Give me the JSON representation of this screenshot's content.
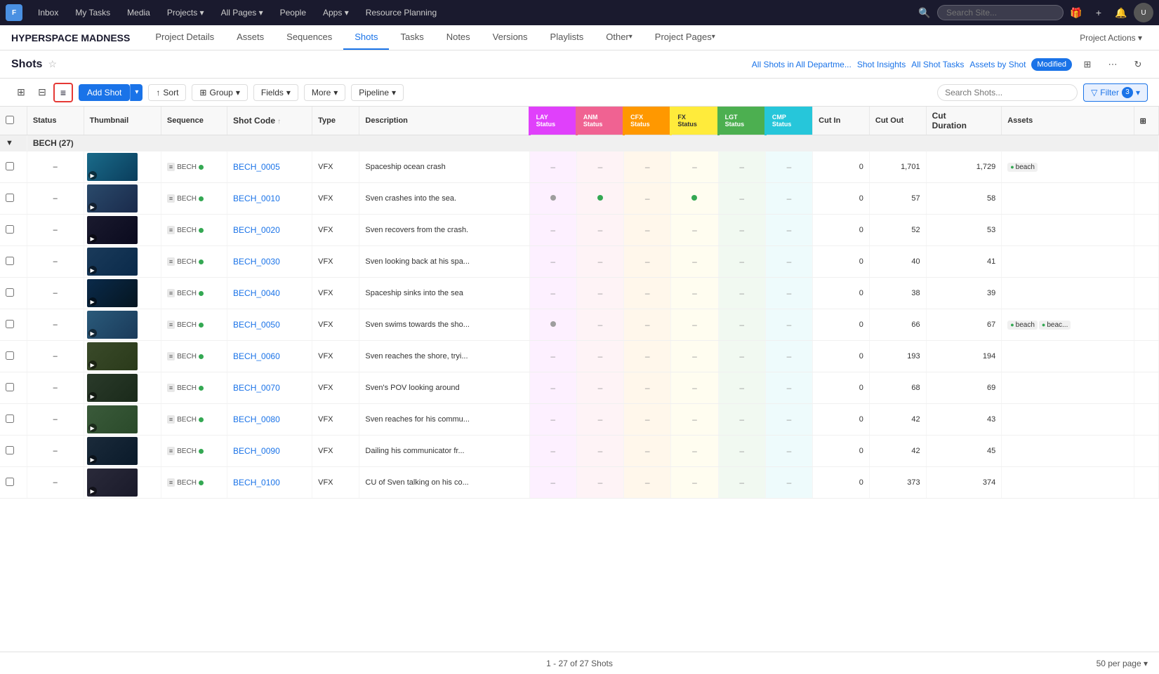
{
  "app": {
    "logo_text": "F",
    "nav_items": [
      "Inbox",
      "My Tasks",
      "Media",
      "Projects",
      "All Pages",
      "People",
      "Apps",
      "Resource Planning"
    ],
    "nav_with_arrow": [
      3,
      4,
      6
    ],
    "search_placeholder": "Search Site...",
    "project_name": "HYPERSPACE MADNESS",
    "project_actions_label": "Project Actions ▾"
  },
  "project_tabs": [
    {
      "label": "Project Details",
      "active": false
    },
    {
      "label": "Assets",
      "active": false
    },
    {
      "label": "Sequences",
      "active": false
    },
    {
      "label": "Shots",
      "active": true
    },
    {
      "label": "Tasks",
      "active": false
    },
    {
      "label": "Notes",
      "active": false
    },
    {
      "label": "Versions",
      "active": false
    },
    {
      "label": "Playlists",
      "active": false
    },
    {
      "label": "Other",
      "active": false,
      "arrow": true
    },
    {
      "label": "Project Pages",
      "active": false,
      "arrow": true
    }
  ],
  "page_title": "Shots",
  "page_header_links": [
    {
      "label": "All Shots in All Departme..."
    },
    {
      "label": "Shot Insights"
    },
    {
      "label": "All Shot Tasks"
    },
    {
      "label": "Assets by Shot"
    }
  ],
  "modified_badge": "Modified",
  "toolbar": {
    "add_shot_label": "Add Shot",
    "sort_label": "Sort",
    "group_label": "Group",
    "fields_label": "Fields",
    "more_label": "More",
    "pipeline_label": "Pipeline",
    "search_placeholder": "Search Shots...",
    "filter_label": "Filter",
    "filter_count": "3"
  },
  "columns": [
    {
      "label": "Status",
      "key": "status"
    },
    {
      "label": "Thumbnail",
      "key": "thumbnail"
    },
    {
      "label": "Sequence",
      "key": "sequence"
    },
    {
      "label": "Shot Code",
      "key": "shot_code",
      "sort": true
    },
    {
      "label": "Type",
      "key": "type"
    },
    {
      "label": "Description",
      "key": "description"
    },
    {
      "label": "LAY Status",
      "key": "lay_status",
      "pipeline": true,
      "color": "lay"
    },
    {
      "label": "ANM Status",
      "key": "anm_status",
      "pipeline": true,
      "color": "anm"
    },
    {
      "label": "CFX Status",
      "key": "cfx_status",
      "pipeline": true,
      "color": "cfx"
    },
    {
      "label": "FX Status",
      "key": "fx_status",
      "pipeline": true,
      "color": "fx"
    },
    {
      "label": "LGT Status",
      "key": "lgt_status",
      "pipeline": true,
      "color": "lgt"
    },
    {
      "label": "CMP Status",
      "key": "cmp_status",
      "pipeline": true,
      "color": "cmp"
    },
    {
      "label": "Cut In",
      "key": "cut_in"
    },
    {
      "label": "Cut Out",
      "key": "cut_out"
    },
    {
      "label": "Cut Duration",
      "key": "cut_duration"
    },
    {
      "label": "Assets",
      "key": "assets"
    }
  ],
  "group": {
    "name": "BECH",
    "count": 27
  },
  "shots": [
    {
      "id": "1",
      "status": "-",
      "thumb_class": "thumb-beach",
      "sequence": "BECH",
      "seq_dot": "green",
      "shot_code": "BECH_0005",
      "type": "VFX",
      "description": "Spaceship ocean crash",
      "lay": "",
      "anm": "",
      "cfx": "",
      "fx": "",
      "lgt": "",
      "cmp": "",
      "cut_in": "0",
      "cut_out": "1,701",
      "cut_duration": "1,729",
      "assets": "beach"
    },
    {
      "id": "2",
      "status": "-",
      "thumb_class": "thumb-crash",
      "sequence": "BECH",
      "seq_dot": "green",
      "shot_code": "BECH_0010",
      "type": "VFX",
      "description": "Sven crashes into the sea.",
      "lay": "gray",
      "anm": "green",
      "cfx": "",
      "fx": "green",
      "lgt": "",
      "cmp": "",
      "cut_in": "0",
      "cut_out": "57",
      "cut_duration": "58",
      "assets": ""
    },
    {
      "id": "3",
      "status": "-",
      "thumb_class": "thumb-recover",
      "sequence": "BECH",
      "seq_dot": "green",
      "shot_code": "BECH_0020",
      "type": "VFX",
      "description": "Sven recovers from the crash.",
      "lay": "",
      "anm": "",
      "cfx": "",
      "fx": "",
      "lgt": "",
      "cmp": "",
      "cut_in": "0",
      "cut_out": "52",
      "cut_duration": "53",
      "assets": ""
    },
    {
      "id": "4",
      "status": "-",
      "thumb_class": "thumb-look",
      "sequence": "BECH",
      "seq_dot": "green",
      "shot_code": "BECH_0030",
      "type": "VFX",
      "description": "Sven looking back at his spa...",
      "lay": "",
      "anm": "",
      "cfx": "",
      "fx": "",
      "lgt": "",
      "cmp": "",
      "cut_in": "0",
      "cut_out": "40",
      "cut_duration": "41",
      "assets": ""
    },
    {
      "id": "5",
      "status": "-",
      "thumb_class": "thumb-sink",
      "sequence": "BECH",
      "seq_dot": "green",
      "shot_code": "BECH_0040",
      "type": "VFX",
      "description": "Spaceship sinks into the sea",
      "lay": "",
      "anm": "",
      "cfx": "",
      "fx": "",
      "lgt": "",
      "cmp": "",
      "cut_in": "0",
      "cut_out": "38",
      "cut_duration": "39",
      "assets": ""
    },
    {
      "id": "6",
      "status": "-",
      "thumb_class": "thumb-swim",
      "sequence": "BECH",
      "seq_dot": "green",
      "shot_code": "BECH_0050",
      "type": "VFX",
      "description": "Sven swims towards the sho...",
      "lay": "gray",
      "anm": "",
      "cfx": "",
      "fx": "",
      "lgt": "",
      "cmp": "",
      "cut_in": "0",
      "cut_out": "66",
      "cut_duration": "67",
      "assets": "beach, beac..."
    },
    {
      "id": "7",
      "status": "-",
      "thumb_class": "thumb-shore",
      "sequence": "BECH",
      "seq_dot": "green",
      "shot_code": "BECH_0060",
      "type": "VFX",
      "description": "Sven reaches the shore, tryi...",
      "lay": "",
      "anm": "",
      "cfx": "",
      "fx": "",
      "lgt": "",
      "cmp": "",
      "cut_in": "0",
      "cut_out": "193",
      "cut_duration": "194",
      "assets": ""
    },
    {
      "id": "8",
      "status": "-",
      "thumb_class": "thumb-pov",
      "sequence": "BECH",
      "seq_dot": "green",
      "shot_code": "BECH_0070",
      "type": "VFX",
      "description": "Sven's POV looking around",
      "lay": "",
      "anm": "",
      "cfx": "",
      "fx": "",
      "lgt": "",
      "cmp": "",
      "cut_in": "0",
      "cut_out": "68",
      "cut_duration": "69",
      "assets": ""
    },
    {
      "id": "9",
      "status": "-",
      "thumb_class": "thumb-reach",
      "sequence": "BECH",
      "seq_dot": "green",
      "shot_code": "BECH_0080",
      "type": "VFX",
      "description": "Sven reaches for his commu...",
      "lay": "",
      "anm": "",
      "cfx": "",
      "fx": "",
      "lgt": "",
      "cmp": "",
      "cut_in": "0",
      "cut_out": "42",
      "cut_duration": "43",
      "assets": ""
    },
    {
      "id": "10",
      "status": "-",
      "thumb_class": "thumb-comms",
      "sequence": "BECH",
      "seq_dot": "green",
      "shot_code": "BECH_0090",
      "type": "VFX",
      "description": "Dailing his communicator fr...",
      "lay": "",
      "anm": "",
      "cfx": "",
      "fx": "",
      "lgt": "",
      "cmp": "",
      "cut_in": "0",
      "cut_out": "42",
      "cut_duration": "45",
      "assets": ""
    },
    {
      "id": "11",
      "status": "-",
      "thumb_class": "thumb-dial",
      "sequence": "BECH",
      "seq_dot": "green",
      "shot_code": "BECH_0100",
      "type": "VFX",
      "description": "CU of Sven talking on his co...",
      "lay": "",
      "anm": "",
      "cfx": "",
      "fx": "",
      "lgt": "",
      "cmp": "",
      "cut_in": "0",
      "cut_out": "373",
      "cut_duration": "374",
      "assets": ""
    }
  ],
  "pagination": {
    "label": "1 - 27 of 27 Shots",
    "per_page": "50 per page ▾"
  }
}
